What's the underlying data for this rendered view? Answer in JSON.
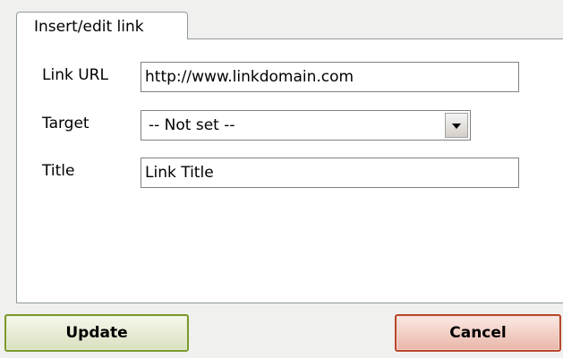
{
  "tab": {
    "label": "Insert/edit link"
  },
  "form": {
    "link_url": {
      "label": "Link URL",
      "value": "http://www.linkdomain.com"
    },
    "target": {
      "label": "Target",
      "selected": "-- Not set --"
    },
    "title": {
      "label": "Title",
      "value": "Link Title"
    }
  },
  "buttons": {
    "update": "Update",
    "cancel": "Cancel"
  },
  "icons": {
    "select_arrow": "chevron-down-icon"
  },
  "colors": {
    "update_border": "#7a9a2c",
    "cancel_border": "#b8462a"
  }
}
